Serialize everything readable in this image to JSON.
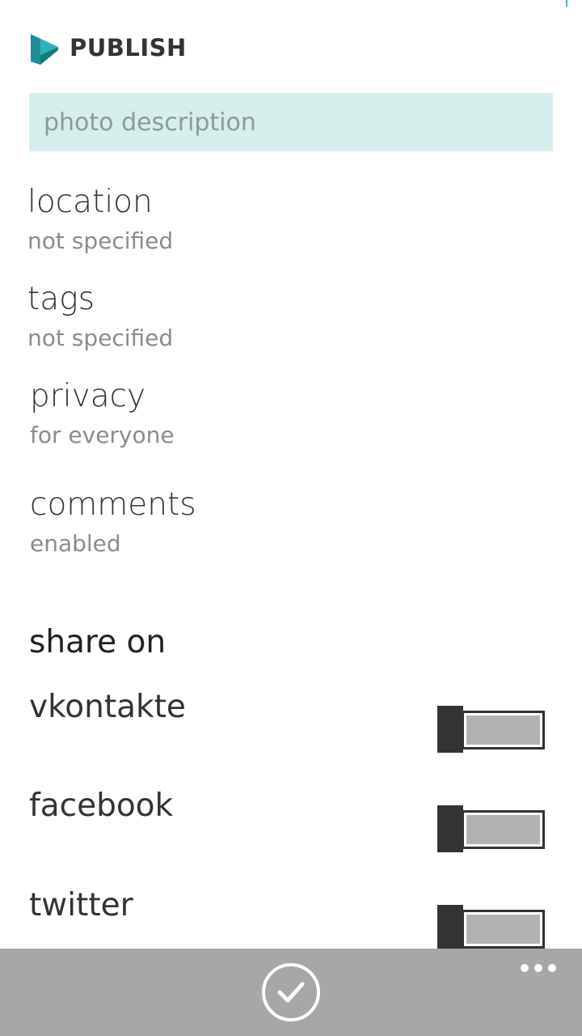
{
  "header": {
    "title": "PUBLISH",
    "logo_icon": "publish-logo-icon"
  },
  "description": {
    "placeholder": "photo description",
    "value": ""
  },
  "settings": [
    {
      "label": "location",
      "value": "not specified"
    },
    {
      "label": "tags",
      "value": "not specified"
    },
    {
      "label": "privacy",
      "value": "for everyone"
    },
    {
      "label": "comments",
      "value": "enabled"
    }
  ],
  "share": {
    "heading": "share on",
    "services": [
      {
        "label": "vkontakte",
        "enabled": false
      },
      {
        "label": "facebook",
        "enabled": false
      },
      {
        "label": "twitter",
        "enabled": false
      }
    ]
  },
  "app_bar": {
    "confirm_icon": "check-icon",
    "more_icon": "ellipsis-icon"
  },
  "colors": {
    "accent_field": "#d6efec",
    "logo_teal": "#1fa3a8",
    "app_bar": "#a7a7a7",
    "toggle_dark": "#333333",
    "toggle_fill": "#b2b2b2"
  }
}
